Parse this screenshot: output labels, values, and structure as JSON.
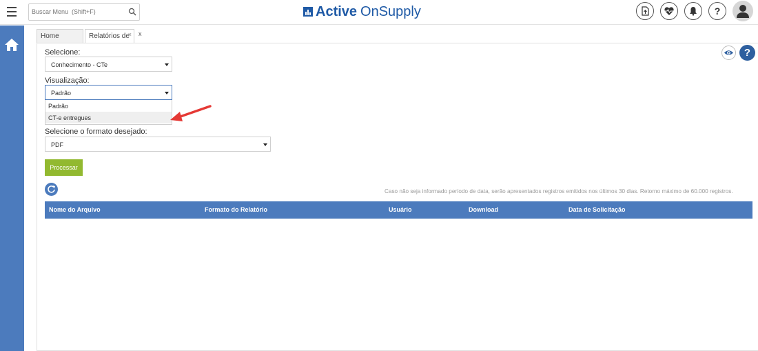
{
  "header": {
    "search_placeholder": "Buscar Menu  (Shift+F)",
    "brand_active": "Active",
    "brand_onsupply": "OnSupply",
    "brand_color": "#1f5aa6"
  },
  "tabs": [
    {
      "label": "Home"
    },
    {
      "label": "Relatórios de",
      "close": "×"
    }
  ],
  "tab_extra_close": "x",
  "form": {
    "selecione_label": "Selecione:",
    "selecione_value": "Conhecimento - CTe",
    "visualizacao_label": "Visualização:",
    "visualizacao_value": "Padrão",
    "visualizacao_options": [
      "Padrão",
      "CT-e entregues"
    ],
    "formato_label": "Selecione o formato desejado:",
    "formato_value": "PDF",
    "process_button": "Processar"
  },
  "info": "Caso não seja informado período de data, serão apresentados registros emitidos nos últimos 30 dias. Retorno máximo de 60.000 registros.",
  "table": {
    "columns": [
      "Nome do Arquivo",
      "Formato do Relatório",
      "Usuário",
      "Download",
      "Data de Solicitação"
    ]
  },
  "help_glyph": "?",
  "colors": {
    "sidebar": "#4c7bbd",
    "table_header": "#4c7bbd",
    "process_button": "#92b930",
    "arrow": "#e53935"
  },
  "icons": {
    "menu": "hamburger-icon",
    "search": "search-icon",
    "upload": "upload-file-icon",
    "health": "heartbeat-icon",
    "notifications": "bell-icon",
    "help": "question-icon",
    "user": "user-avatar-icon",
    "home": "home-icon",
    "visibility": "eye-icon",
    "refresh": "refresh-icon"
  }
}
